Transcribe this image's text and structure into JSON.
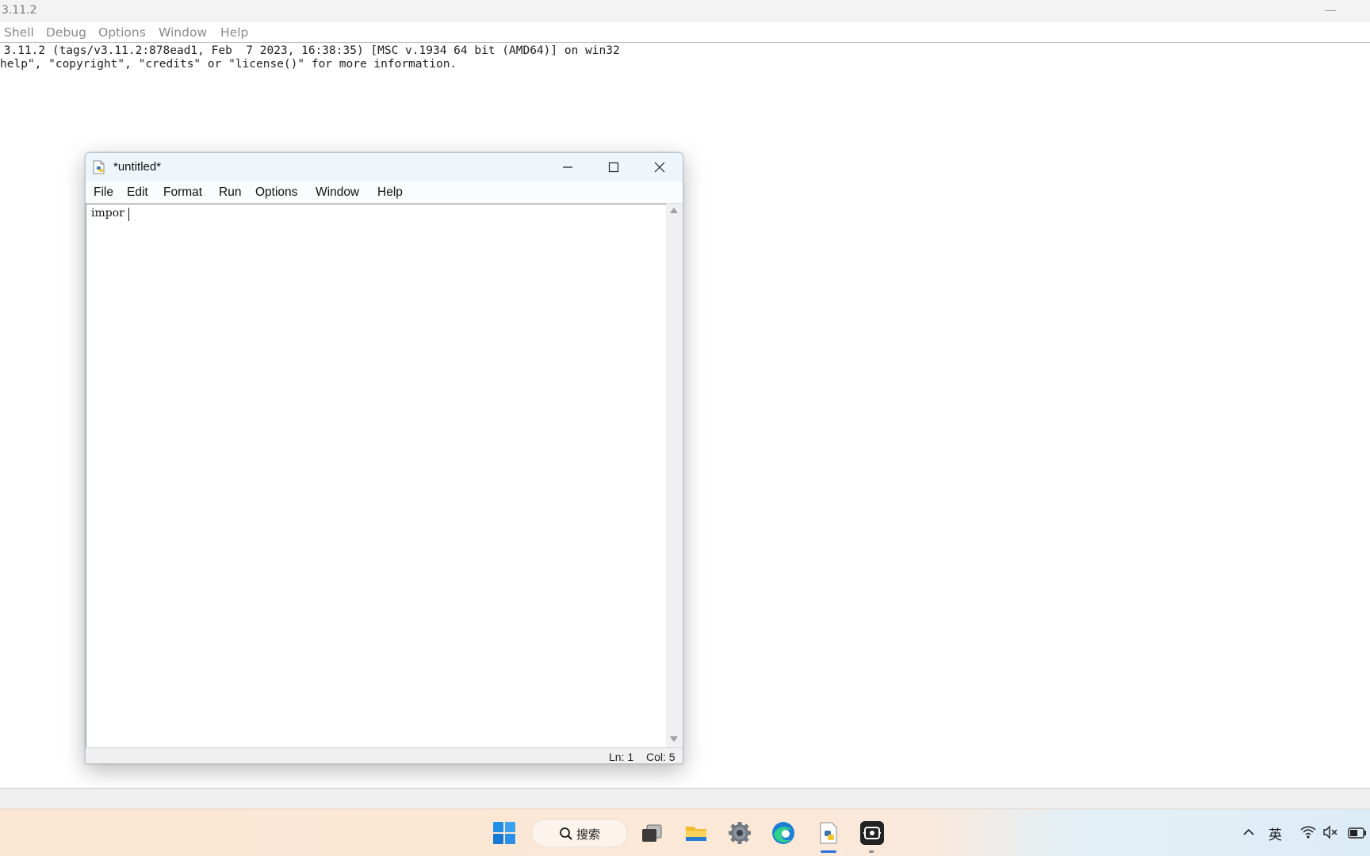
{
  "shell": {
    "title": "3.11.2",
    "menu": [
      "Shell",
      "Debug",
      "Options",
      "Window",
      "Help"
    ],
    "output_lines": [
      " 3.11.2 (tags/v3.11.2:878ead1, Feb  7 2023, 16:38:35) [MSC v.1934 64 bit (AMD64)] on win32",
      "help\", \"copyright\", \"credits\" or \"license()\" for more information."
    ]
  },
  "editor": {
    "title": "*untitled*",
    "menu": [
      "File",
      "Edit",
      "Format",
      "Run",
      "Options",
      "Window",
      "Help"
    ],
    "content": "impor",
    "status": {
      "line": "Ln: 1",
      "col": "Col: 5"
    }
  },
  "taskbar": {
    "search_label": "搜索",
    "ime_indicator": "英",
    "icons": [
      "windows-start-icon",
      "search-icon",
      "task-view-icon",
      "file-explorer-icon",
      "settings-gear-icon",
      "edge-browser-icon",
      "python-idle-icon",
      "screen-capture-icon"
    ],
    "accent_color": "#2a6fdb"
  }
}
